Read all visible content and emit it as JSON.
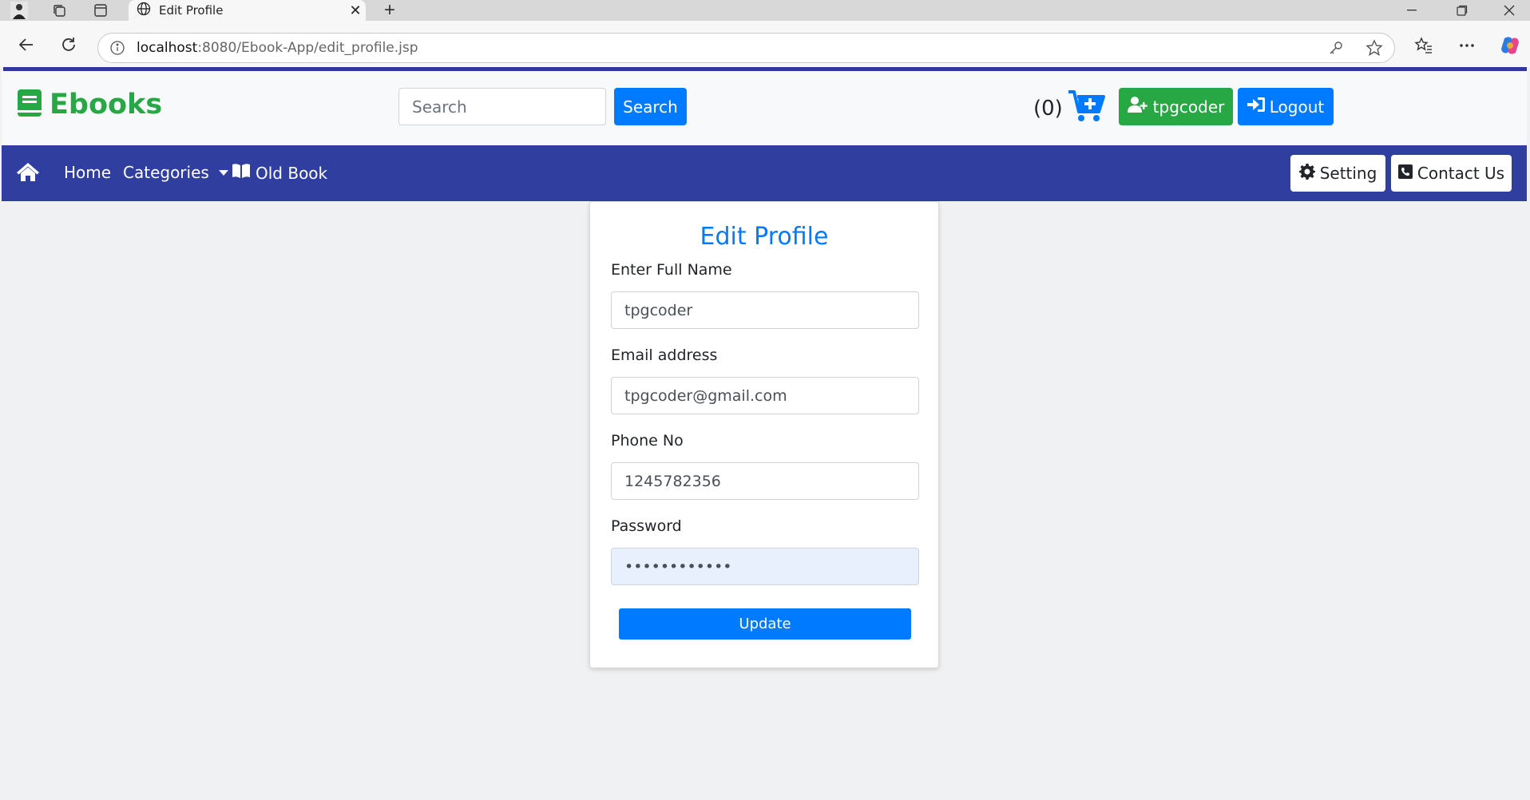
{
  "browser": {
    "tab_title": "Edit Profile",
    "tab_close": "✕",
    "new_tab": "+",
    "url_host": "localhost",
    "url_path": ":8080/Ebook-App/edit_profile.jsp"
  },
  "header": {
    "brand": "Ebooks",
    "search_placeholder": "Search",
    "search_button": "Search",
    "cart_count": "(0)",
    "user_button": "tpgcoder",
    "logout_button": "Logout"
  },
  "nav": {
    "home": "Home",
    "categories": "Categories",
    "old_book": "Old Book",
    "setting": "Setting",
    "contact": "Contact Us"
  },
  "form": {
    "title": "Edit Profile",
    "fullname_label": "Enter Full Name",
    "fullname_value": "tpgcoder",
    "email_label": "Email address",
    "email_value": "tpgcoder@gmail.com",
    "phone_label": "Phone No",
    "phone_value": "1245782356",
    "password_label": "Password",
    "password_value": "••••••••••••",
    "update_button": "Update"
  },
  "colors": {
    "brand_green": "#28a745",
    "primary_blue": "#007bff",
    "nav_indigo": "#303f9f"
  }
}
